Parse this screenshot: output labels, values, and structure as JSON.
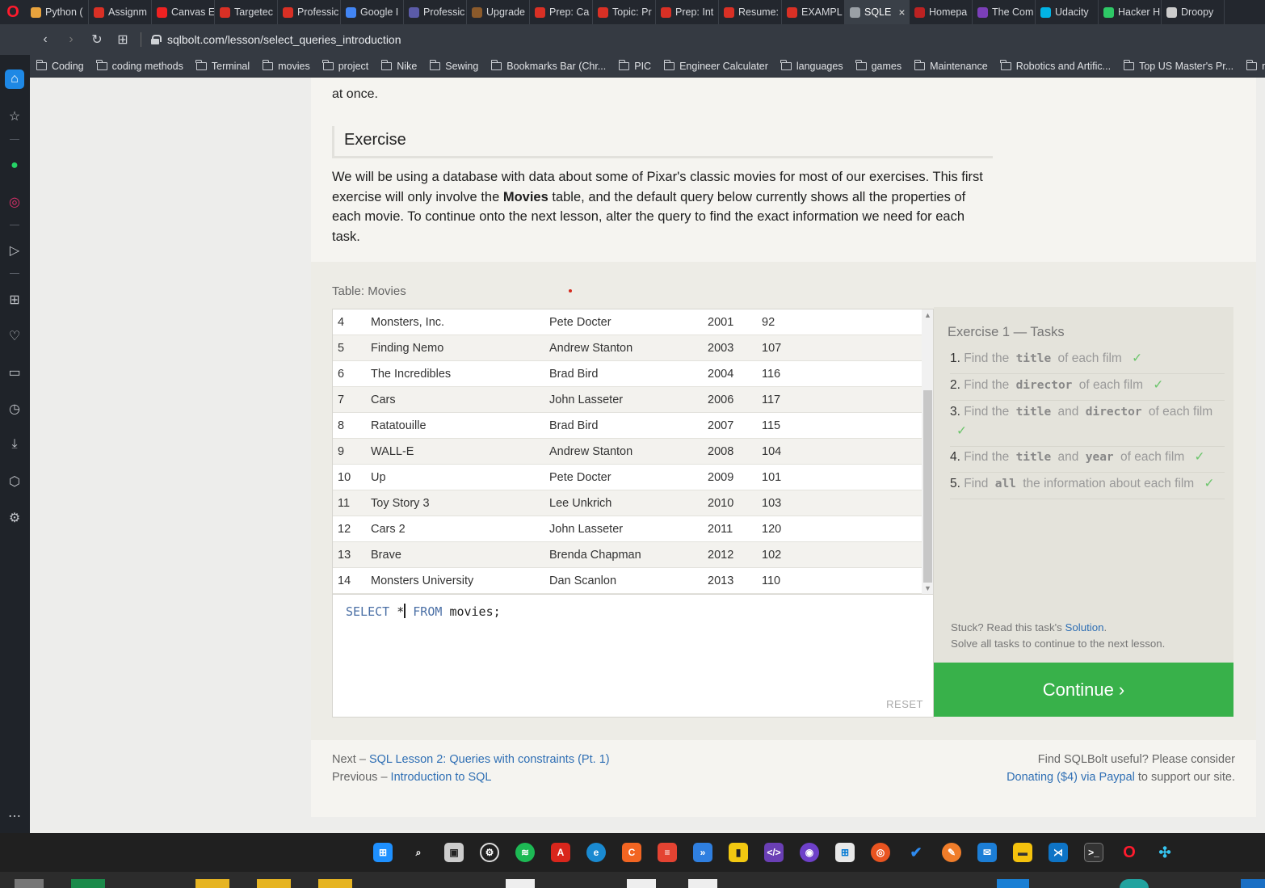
{
  "browser": {
    "tabs": [
      {
        "label": "Python (",
        "color": "#e8a33d"
      },
      {
        "label": "Assignm",
        "color": "#d93025"
      },
      {
        "label": "Canvas E",
        "color": "#e22"
      },
      {
        "label": "Targetec",
        "color": "#d93025"
      },
      {
        "label": "Professic",
        "color": "#d93025"
      },
      {
        "label": "Google I",
        "color": "#4285f4"
      },
      {
        "label": "Professic",
        "color": "#5b5ba8"
      },
      {
        "label": "Upgrade",
        "color": "#8b5a2b"
      },
      {
        "label": "Prep: Ca",
        "color": "#d93025"
      },
      {
        "label": "Topic: Pr",
        "color": "#d93025"
      },
      {
        "label": "Prep: Int",
        "color": "#d93025"
      },
      {
        "label": "Resume:",
        "color": "#d93025"
      },
      {
        "label": "EXAMPL",
        "color": "#d93025"
      },
      {
        "label": "SQLE",
        "color": "#9aa0a6",
        "active": true
      },
      {
        "label": "Homepa",
        "color": "#b22"
      },
      {
        "label": "The Com",
        "color": "#7b3fb8"
      },
      {
        "label": "Udacity",
        "color": "#02b3e4"
      },
      {
        "label": "Hacker H",
        "color": "#2ec866"
      },
      {
        "label": "Droopy",
        "color": "#ccc"
      }
    ],
    "url": "sqlbolt.com/lesson/select_queries_introduction",
    "bookmarks": [
      "Coding",
      "coding methods",
      "Terminal",
      "movies",
      "project",
      "Nike",
      "Sewing",
      "Bookmarks Bar (Chr...",
      "PIC",
      "Engineer Calculater",
      "languages",
      "games",
      "Maintenance",
      "Robotics and Artific...",
      "Top US Master's Pr...",
      "mou"
    ]
  },
  "lesson": {
    "intro_tail": "at once.",
    "exercise_heading": "Exercise",
    "exercise_text_1": "We will be using a database with data about some of Pixar's classic movies for most of our exercises. This first exercise will only involve the ",
    "exercise_text_bold": "Movies",
    "exercise_text_2": " table, and the default query below currently shows all the properties of each movie. To continue onto the next lesson, alter the query to find the exact information we need for each task."
  },
  "table": {
    "label": "Table: Movies",
    "rows": [
      [
        "4",
        "Monsters, Inc.",
        "Pete Docter",
        "2001",
        "92"
      ],
      [
        "5",
        "Finding Nemo",
        "Andrew Stanton",
        "2003",
        "107"
      ],
      [
        "6",
        "The Incredibles",
        "Brad Bird",
        "2004",
        "116"
      ],
      [
        "7",
        "Cars",
        "John Lasseter",
        "2006",
        "117"
      ],
      [
        "8",
        "Ratatouille",
        "Brad Bird",
        "2007",
        "115"
      ],
      [
        "9",
        "WALL-E",
        "Andrew Stanton",
        "2008",
        "104"
      ],
      [
        "10",
        "Up",
        "Pete Docter",
        "2009",
        "101"
      ],
      [
        "11",
        "Toy Story 3",
        "Lee Unkrich",
        "2010",
        "103"
      ],
      [
        "12",
        "Cars 2",
        "John Lasseter",
        "2011",
        "120"
      ],
      [
        "13",
        "Brave",
        "Brenda Chapman",
        "2012",
        "102"
      ],
      [
        "14",
        "Monsters University",
        "Dan Scanlon",
        "2013",
        "110"
      ]
    ]
  },
  "editor": {
    "kw_select": "SELECT",
    "star": "*",
    "kw_from": "FROM",
    "rest": "movies;",
    "reset_label": "RESET"
  },
  "tasks": {
    "title": "Exercise 1 — Tasks",
    "items": [
      {
        "num": "1.",
        "pre": "Find the",
        "code1": "title",
        "mid": "",
        "code2": "",
        "post": "of each film"
      },
      {
        "num": "2.",
        "pre": "Find the",
        "code1": "director",
        "mid": "",
        "code2": "",
        "post": "of each film"
      },
      {
        "num": "3.",
        "pre": "Find the",
        "code1": "title",
        "mid": "and",
        "code2": "director",
        "post": "of each film"
      },
      {
        "num": "4.",
        "pre": "Find the",
        "code1": "title",
        "mid": "and",
        "code2": "year",
        "post": "of each film"
      },
      {
        "num": "5.",
        "pre": "Find",
        "code1": "all",
        "mid": "",
        "code2": "",
        "post": "the information about each film"
      }
    ],
    "check": "✓",
    "stuck_pre": "Stuck? Read this task's ",
    "stuck_link": "Solution",
    "stuck_post": ".",
    "solve_all": "Solve all tasks to continue to the next lesson.",
    "continue_label": "Continue ›"
  },
  "footer": {
    "next_pre": "Next – ",
    "next_link": "SQL Lesson 2: Queries with constraints (Pt. 1)",
    "prev_pre": "Previous – ",
    "prev_link": "Introduction to SQL",
    "useful": "Find SQLBolt useful? Please consider",
    "donate_link": "Donating ($4) via Paypal",
    "donate_post": " to support our site."
  },
  "colors": {
    "continue": "#38b14a",
    "link": "#2f6fb4",
    "check": "#6cc56c"
  }
}
